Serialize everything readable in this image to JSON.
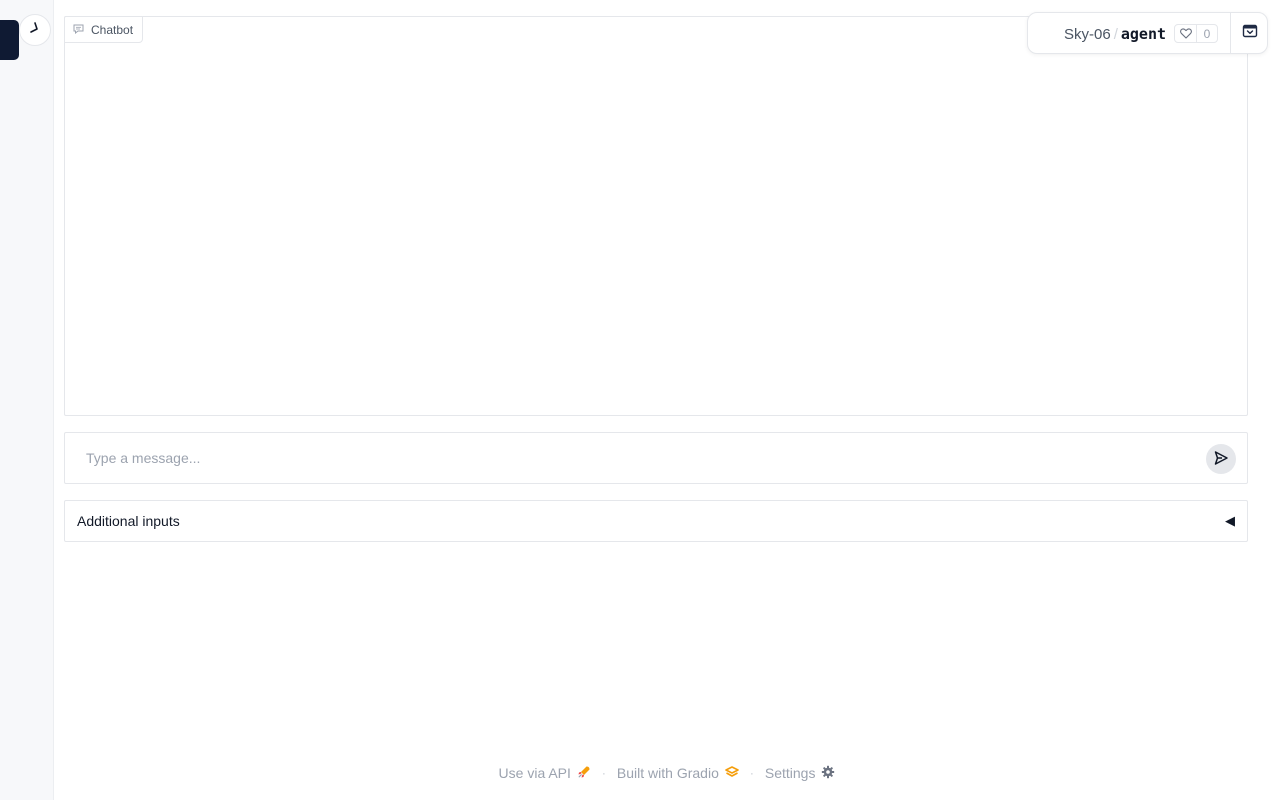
{
  "sidebar": {
    "toggle_icon": "chevron-icon"
  },
  "chatbot": {
    "label": "Chatbot",
    "label_icon": "chat-bubble-icon"
  },
  "input": {
    "placeholder": "Type a message...",
    "value": "",
    "send_icon": "send-icon"
  },
  "accordion": {
    "label": "Additional inputs",
    "arrow": "◀"
  },
  "footer": {
    "api_label": "Use via API",
    "api_icon": "rocket-icon",
    "separator": "·",
    "gradio_label": "Built with Gradio",
    "gradio_icon": "gradio-logo-icon",
    "settings_label": "Settings",
    "settings_icon": "gear-icon"
  },
  "space_badge": {
    "owner": "Sky-06",
    "separator": "/",
    "name": "agent",
    "like_count": "0",
    "like_icon": "heart-icon",
    "menu_icon": "collapse-icon"
  },
  "colors": {
    "sidebar_tab": "#0f1a33",
    "border": "#e5e7eb",
    "footer_text": "#9ca3af",
    "gradio_orange": "#f59e0b"
  }
}
